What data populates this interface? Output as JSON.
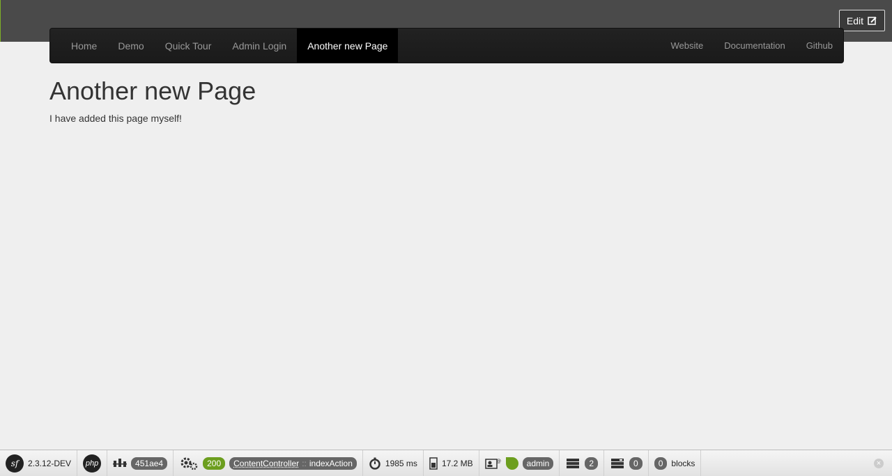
{
  "edit_button": {
    "label": "Edit"
  },
  "nav": {
    "left": [
      {
        "label": "Home"
      },
      {
        "label": "Demo"
      },
      {
        "label": "Quick Tour"
      },
      {
        "label": "Admin Login"
      },
      {
        "label": "Another new Page",
        "active": true
      }
    ],
    "right": [
      {
        "label": "Website"
      },
      {
        "label": "Documentation"
      },
      {
        "label": "Github"
      }
    ]
  },
  "page": {
    "title": "Another new Page",
    "text": "I have added this page myself!"
  },
  "toolbar": {
    "sf_logo": "sf",
    "version": "2.3.12-DEV",
    "php_logo": "php",
    "token": "451ae4",
    "status": "200",
    "controller": "ContentController",
    "controller_sep": "::",
    "action": "indexAction",
    "time": "1985 ms",
    "memory": "17.2 MB",
    "user": "admin",
    "db_queries": "2",
    "cache_count": "0",
    "blocks_count": "0",
    "blocks_label": "blocks",
    "accent_color": "#6c9e1e",
    "close_glyph": "×"
  }
}
